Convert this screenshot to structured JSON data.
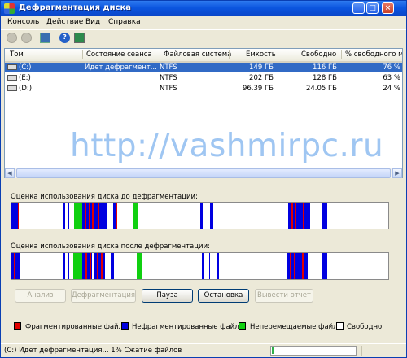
{
  "window": {
    "title": "Дефрагментация диска"
  },
  "menu": [
    {
      "label": "Консоль",
      "key": "К"
    },
    {
      "label": "Действие",
      "key": "Д"
    },
    {
      "label": "Вид",
      "key": "В"
    },
    {
      "label": "Справка",
      "key": "С"
    }
  ],
  "toolbar_icons": [
    "back-icon",
    "forward-icon",
    "console-icon",
    "help-icon",
    "properties-icon"
  ],
  "table": {
    "columns": [
      "Том",
      "Состояние сеанса",
      "Файловая система",
      "Емкость",
      "Свободно",
      "% свободного мест"
    ],
    "rows": [
      {
        "volume": "(C:)",
        "state": "Идет дефрагмент...",
        "fs": "NTFS",
        "capacity": "149 ГБ",
        "free": "116 ГБ",
        "pct": "76 %"
      },
      {
        "volume": "(E:)",
        "state": "",
        "fs": "NTFS",
        "capacity": "202 ГБ",
        "free": "128 ГБ",
        "pct": "63 %"
      },
      {
        "volume": "(D:)",
        "state": "",
        "fs": "NTFS",
        "capacity": "96.39 ГБ",
        "free": "24.05 ГБ",
        "pct": "24 %"
      }
    ]
  },
  "watermark": "http://vashmirpc.ru",
  "analysis": {
    "before_label": "Оценка использования диска до дефрагментации:",
    "after_label": "Оценка использования диска после дефрагментации:"
  },
  "buttons": {
    "analyze": "Анализ",
    "defragment": "Дефрагментация",
    "pause": "Пауза",
    "stop": "Остановка",
    "report": "Вывести отчет"
  },
  "legend": {
    "fragmented": "Фрагментированные файлы",
    "contiguous": "Нефрагментированные файлы",
    "unmovable": "Неперемещаемые файлы",
    "free": "Свободно"
  },
  "colors": {
    "fragmented": "#e00000",
    "contiguous": "#0000e0",
    "unmovable": "#10d010",
    "free": "#ffffff",
    "selection": "#316ac5",
    "title_bar": "#0b55df"
  },
  "status": {
    "text": "(C:) Идет дефрагментация... 1%  Сжатие файлов",
    "progress": 0.01
  }
}
